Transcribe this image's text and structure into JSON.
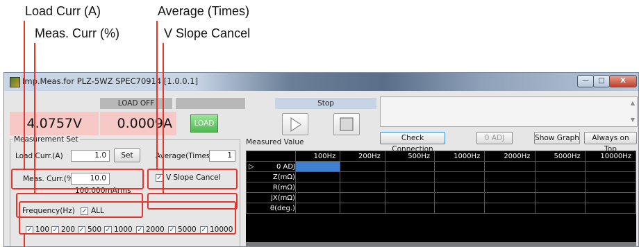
{
  "callouts": {
    "load_curr": "Load Curr (A)",
    "meas_curr": "Meas. Curr (%)",
    "average": "Average (Times)",
    "v_slope": "V Slope Cancel"
  },
  "window": {
    "title": "Imp.Meas.for PLZ-5WZ SPEC70914 [1.0.0.1]",
    "minimize": "—",
    "maximize": "□",
    "close": "X"
  },
  "status": {
    "load_state": "LOAD OFF",
    "voltage": "4.0757V",
    "current": "0.0009A",
    "load_button": "LOAD",
    "run_state": "Stop"
  },
  "toolbar": {
    "check_connection": "Check Connection",
    "zero_adj": "0 ADJ",
    "show_graph": "Show Graph",
    "always_on_top": "Always on Top"
  },
  "measurement_set": {
    "label": "Measurement Set",
    "load_curr_label": "Load Curr.(A)",
    "load_curr_value": "1.0",
    "set_button": "Set",
    "average_label": "Average(Times)",
    "average_value": "1",
    "meas_curr_label": "Meas. Curr.(%)",
    "meas_curr_value": "10.0",
    "meas_curr_rms": "100.000mArms",
    "v_slope_label": "V Slope Cancel",
    "frequency_label": "Frequency(Hz)",
    "all_label": "ALL",
    "frequencies": [
      "100",
      "200",
      "500",
      "1000",
      "2000",
      "5000",
      "10000"
    ]
  },
  "measured_value": {
    "label": "Measured Value",
    "columns": [
      "100Hz",
      "200Hz",
      "500Hz",
      "1000Hz",
      "2000Hz",
      "5000Hz",
      "10000Hz"
    ],
    "rows": [
      "0 ADJ",
      "Z(mΩ)",
      "R(mΩ)",
      "jX(mΩ)",
      "θ(deg.)"
    ]
  }
}
